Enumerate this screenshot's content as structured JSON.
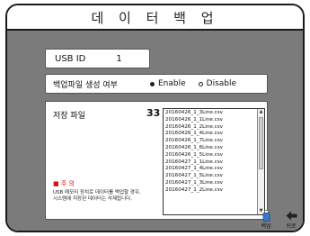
{
  "window": {
    "title": "데 이 터  백 업"
  },
  "usb": {
    "label": "USB ID",
    "value": "1"
  },
  "backup_option": {
    "label": "백업파일 생성 여부",
    "options": [
      {
        "label": "Enable",
        "selected": true
      },
      {
        "label": "Disable",
        "selected": false
      }
    ]
  },
  "save_files": {
    "label": "저장 파일",
    "count": "33",
    "files": [
      "20160426_1_3Line.csv",
      "20160426_1_1Line.csv",
      "20160426_1_2Line.csv",
      "20160426_1_4Line.csv",
      "20160426_1_7Line.csv",
      "20160426_1_6Line.csv",
      "20160426_1_5Line.csv",
      "20160427_1_1Line.csv",
      "20160427_1_4Line.csv",
      "20160427_1_5Line.csv",
      "20160427_1_3Line.csv",
      "20160427_1_2Line.csv"
    ]
  },
  "warning": {
    "title": "■ 주 의",
    "line1": "USB 메모리 장치로 데이터를 백업할 경우,",
    "line2": "시스템에 저장된 데이터는 삭제됩니다."
  },
  "buttons": {
    "backup": "백업",
    "back": "뒤로"
  },
  "colors": {
    "panel": "#7b7b7b",
    "warning": "#d01818",
    "backup_icon": "#3a78c8"
  }
}
